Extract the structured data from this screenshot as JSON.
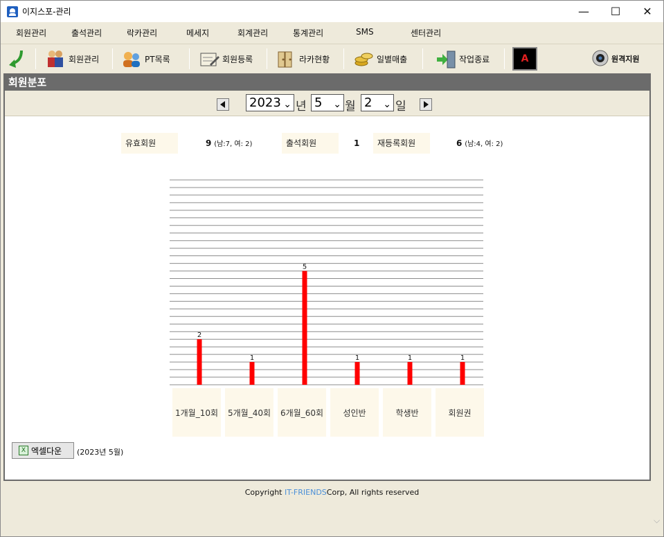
{
  "window": {
    "title": "이지스포-관리",
    "minimize": "—",
    "maximize": "☐",
    "close": "✕"
  },
  "menu": [
    "회원관리",
    "출석관리",
    "락카관리",
    "메세지",
    "회계관리",
    "통계관리",
    "SMS",
    "센터관리"
  ],
  "toolbar": {
    "back_icon": "green-arrow-icon",
    "buttons": [
      {
        "label": "회원관리",
        "icon": "members-icon"
      },
      {
        "label": "PT목록",
        "icon": "pt-people-icon"
      },
      {
        "label": "회원등록",
        "icon": "register-icon"
      },
      {
        "label": "라카현황",
        "icon": "locker-icon"
      },
      {
        "label": "일별매출",
        "icon": "coins-icon"
      },
      {
        "label": "작업종료",
        "icon": "exit-door-icon"
      }
    ],
    "badge": "A",
    "remote_label": "원격지원"
  },
  "panel": {
    "title": "회원분포"
  },
  "date": {
    "year": "2023",
    "year_unit": "년",
    "month": "5",
    "month_unit": "월",
    "day": "2",
    "day_unit": "일"
  },
  "stats": {
    "valid_label": "유효회원",
    "valid_value": "9",
    "valid_detail": "(남:7, 여: 2)",
    "attend_label": "출석회원",
    "attend_value": "1",
    "rereg_label": "재등록회원",
    "rereg_value": "6",
    "rereg_detail": "(남:4, 여: 2)"
  },
  "chart_data": {
    "type": "bar",
    "categories": [
      "1개월_10회",
      "5개월_40회",
      "6개월_60회",
      "성인반",
      "학생반",
      "회원권"
    ],
    "values": [
      2,
      1,
      5,
      1,
      1,
      1
    ],
    "bar_color": "#ff0000",
    "ylim": [
      0,
      9
    ],
    "grid": true
  },
  "excel": {
    "label": "엑셀다운",
    "note": "(2023년 5월)"
  },
  "footer": {
    "prefix": "Copyright ",
    "brand": "IT-FRIENDS",
    "suffix": "Corp,  All rights reserved"
  }
}
